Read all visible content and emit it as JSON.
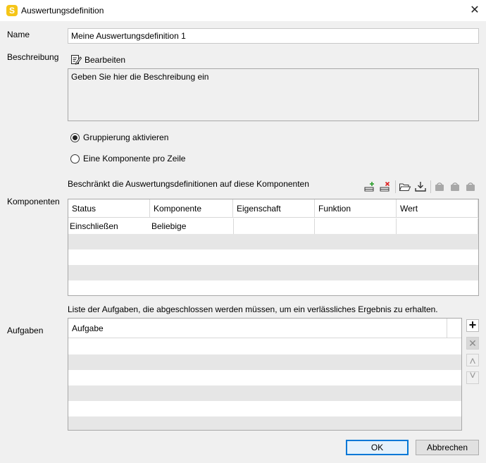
{
  "window": {
    "title": "Auswertungsdefinition",
    "app_icon_letter": "S",
    "close_glyph": "✕"
  },
  "form": {
    "name_label": "Name",
    "name_value": "Meine Auswertungsdefinition 1",
    "description_label": "Beschreibung",
    "edit_label": "Bearbeiten",
    "description_text": "Geben Sie hier die Beschreibung ein",
    "radio_grouping": "Gruppierung aktivieren",
    "radio_per_row": "Eine Komponente pro Zeile",
    "grouping_selected": true
  },
  "components": {
    "label": "Komponenten",
    "hint": "Beschränkt die Auswertungsdefinitionen auf diese Komponenten",
    "columns": [
      "Status",
      "Komponente",
      "Eigenschaft",
      "Funktion",
      "Wert"
    ],
    "rows": [
      [
        "Einschließen",
        "Beliebige",
        "",
        "",
        ""
      ]
    ]
  },
  "tasks": {
    "label": "Aufgaben",
    "hint": "Liste der Aufgaben, die abgeschlossen werden müssen, um ein verlässliches Ergebnis zu erhalten.",
    "column": "Aufgabe",
    "add_glyph": "+",
    "remove_glyph": "✕",
    "up_glyph": "˄",
    "down_glyph": "˅"
  },
  "footer": {
    "ok_label": "OK",
    "cancel_label": "Abbrechen"
  }
}
